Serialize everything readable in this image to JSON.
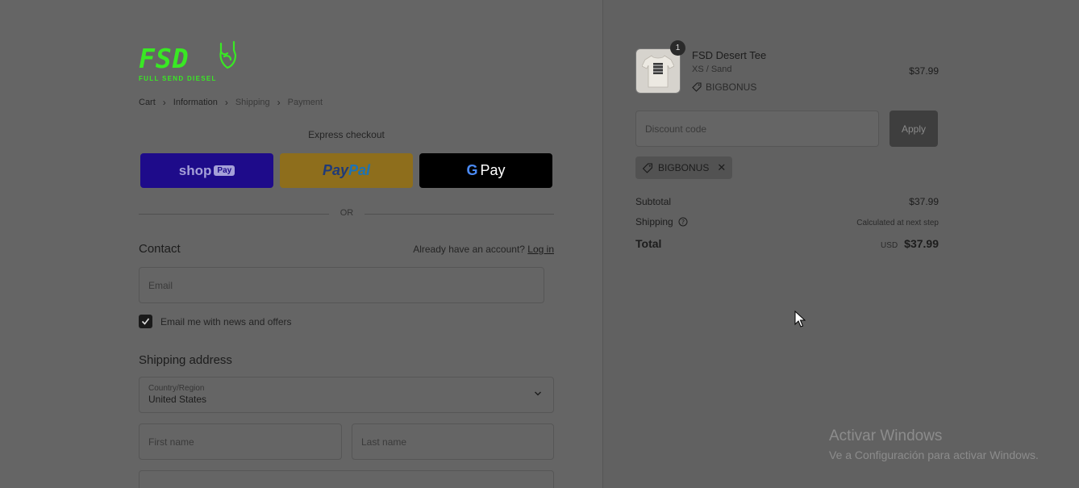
{
  "brand": {
    "logo_text": "FSD",
    "logo_sub": "FULL SEND DIESEL",
    "accent": "#39e824"
  },
  "breadcrumb": {
    "cart": "Cart",
    "information": "Information",
    "shipping": "Shipping",
    "payment": "Payment"
  },
  "express": {
    "label": "Express checkout",
    "shoppay": {
      "text": "shop",
      "pill": "Pay"
    },
    "paypal": {
      "part1": "Pay",
      "part2": "Pal"
    },
    "gpay": {
      "g": "G",
      "text": "Pay"
    },
    "or": "OR"
  },
  "contact": {
    "title": "Contact",
    "account_text": "Already have an account?",
    "login": "Log in",
    "email_placeholder": "Email",
    "newsletter_label": "Email me with news and offers",
    "newsletter_checked": true
  },
  "shipping": {
    "title": "Shipping address",
    "country_label": "Country/Region",
    "country_value": "United States",
    "first_name_placeholder": "First name",
    "last_name_placeholder": "Last name"
  },
  "order": {
    "quantity": "1",
    "product_name": "FSD Desert Tee",
    "product_variant": "XS / Sand",
    "product_discount": "BIGBONUS",
    "product_price": "$37.99",
    "discount_placeholder": "Discount code",
    "apply_label": "Apply",
    "applied_code": "BIGBONUS",
    "subtotal_label": "Subtotal",
    "subtotal_value": "$37.99",
    "shipping_label": "Shipping",
    "shipping_value": "Calculated at next step",
    "total_label": "Total",
    "currency": "USD",
    "total_value": "$37.99"
  },
  "watermark": {
    "title": "Activar Windows",
    "subtitle": "Ve a Configuración para activar Windows."
  }
}
